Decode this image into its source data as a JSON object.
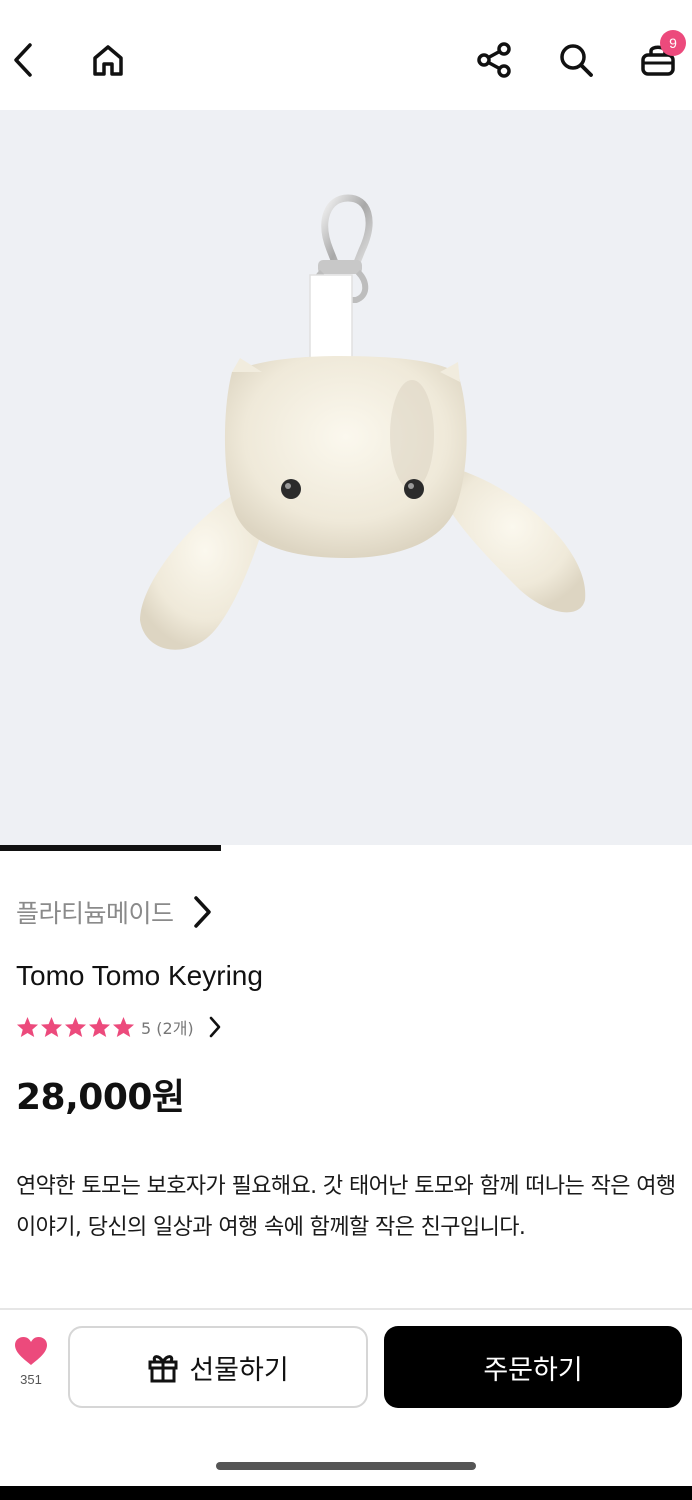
{
  "header": {
    "back_icon": "chevron-left-icon",
    "home_icon": "home-icon",
    "share_icon": "share-icon",
    "search_icon": "search-icon",
    "cart_icon": "cart-icon",
    "cart_badge": "9"
  },
  "gallery": {
    "image_description": "white plush bunny keyring with metal clasp",
    "progress": 0.32
  },
  "product": {
    "brand": "플라티늄메이드",
    "title": "Tomo Tomo Keyring",
    "rating": {
      "stars": 5,
      "text": "5 (2개)"
    },
    "price": "28,000원",
    "description": "연약한 토모는 보호자가 필요해요. 갓 태어난 토모와 함께 떠나는 작은 여행 이야기, 당신의 일상과 여행 속에 함께할 작은 친구입니다."
  },
  "actions": {
    "like_count": "351",
    "gift_label": "선물하기",
    "order_label": "주문하기"
  },
  "colors": {
    "accent_pink": "#ec4a7c",
    "order_bg": "#000000"
  }
}
